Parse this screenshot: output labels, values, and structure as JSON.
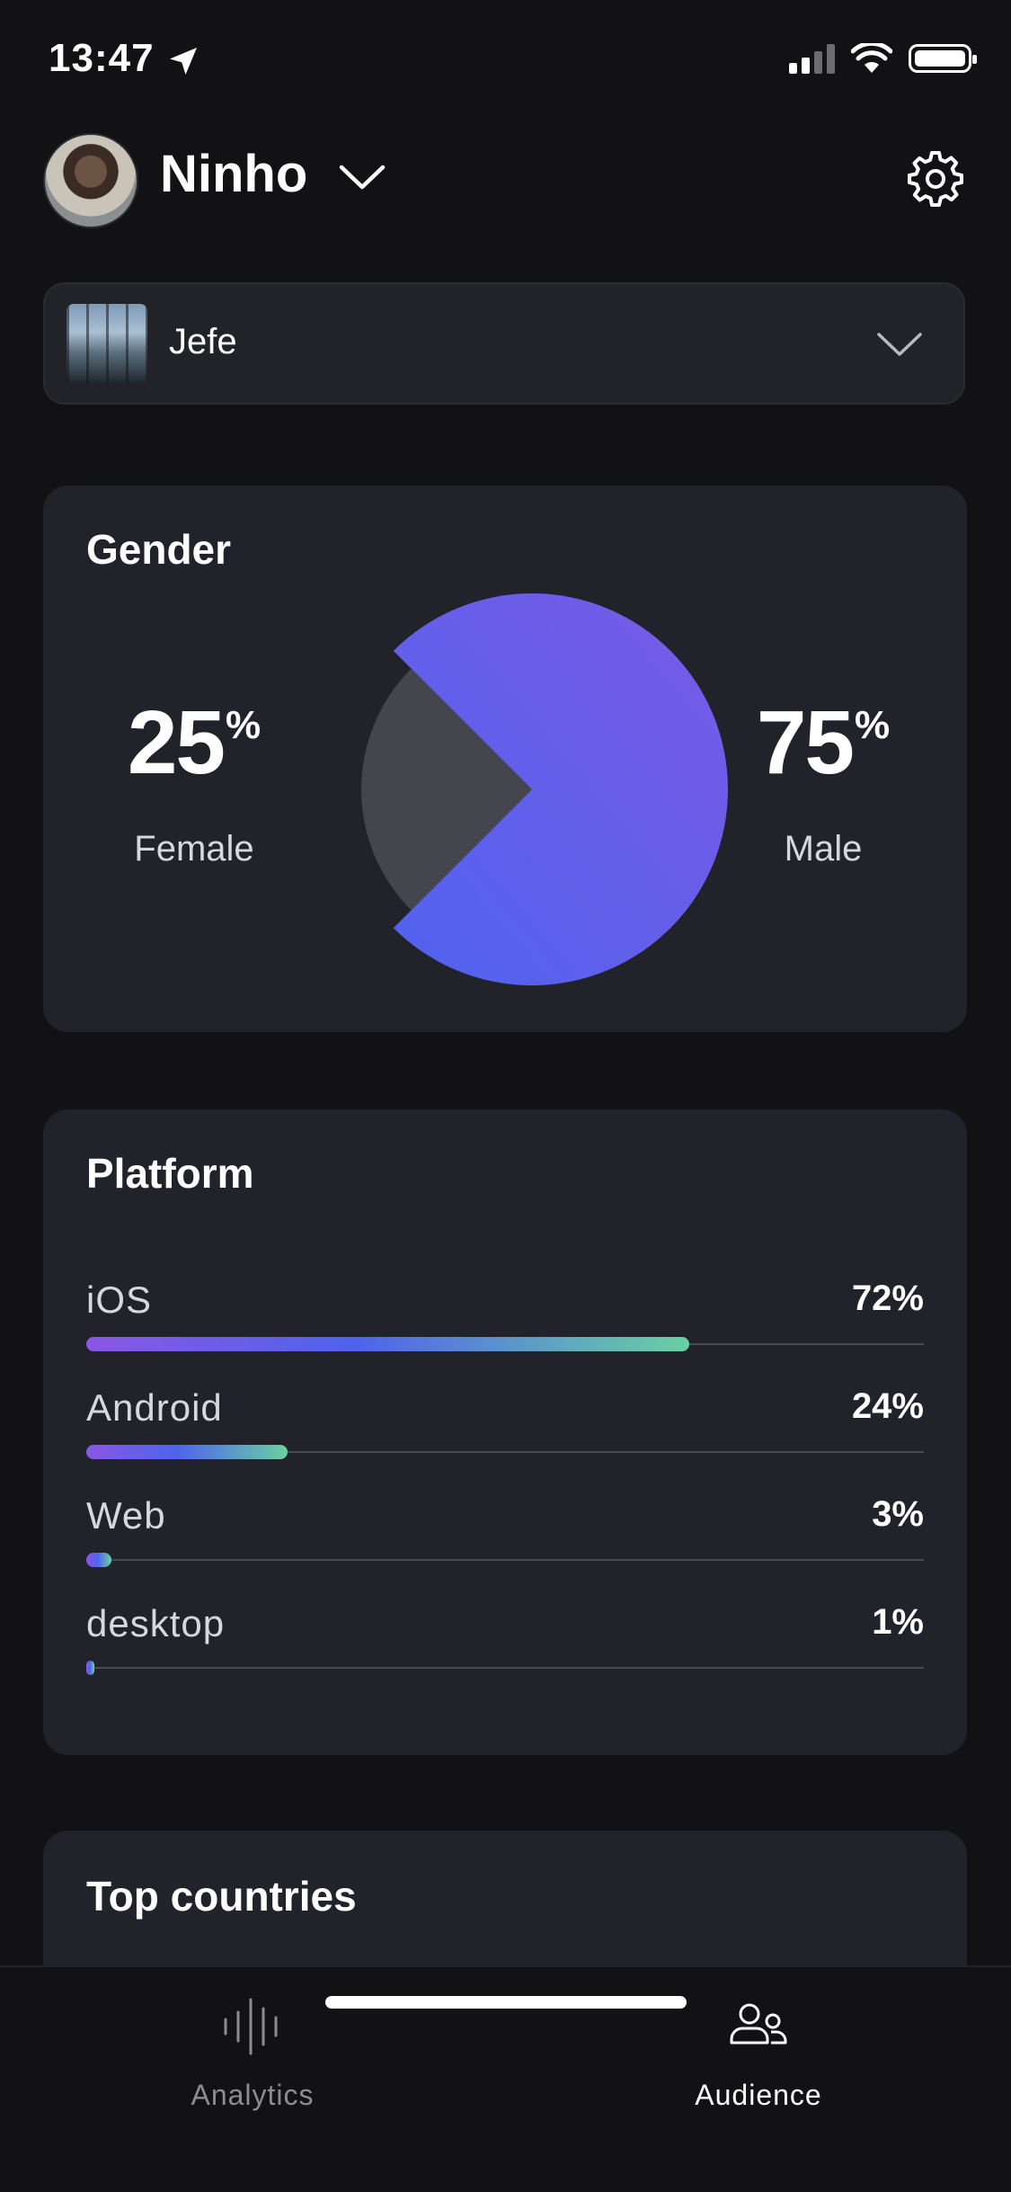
{
  "status_bar": {
    "time": "13:47",
    "signal_bars_active": 2,
    "signal_bars_total": 4
  },
  "header": {
    "user_name": "Ninho"
  },
  "release_selector": {
    "title": "Jefe"
  },
  "gender": {
    "title": "Gender",
    "female": {
      "value": "25",
      "unit": "%",
      "label": "Female"
    },
    "male": {
      "value": "75",
      "unit": "%",
      "label": "Male"
    },
    "colors": {
      "male": "#4f63ee",
      "male_end": "#7a5ae6",
      "female": "#45454d"
    }
  },
  "platform": {
    "title": "Platform",
    "rows": [
      {
        "label": "iOS",
        "value": "72%",
        "fraction": 0.72
      },
      {
        "label": "Android",
        "value": "24%",
        "fraction": 0.24
      },
      {
        "label": "Web",
        "value": "3%",
        "fraction": 0.03
      },
      {
        "label": "desktop",
        "value": "1%",
        "fraction": 0.01
      }
    ]
  },
  "top_countries": {
    "title": "Top countries"
  },
  "tabs": [
    {
      "label": "Analytics",
      "icon": "waveform-icon",
      "active": false
    },
    {
      "label": "Audience",
      "icon": "people-icon",
      "active": true
    }
  ]
}
